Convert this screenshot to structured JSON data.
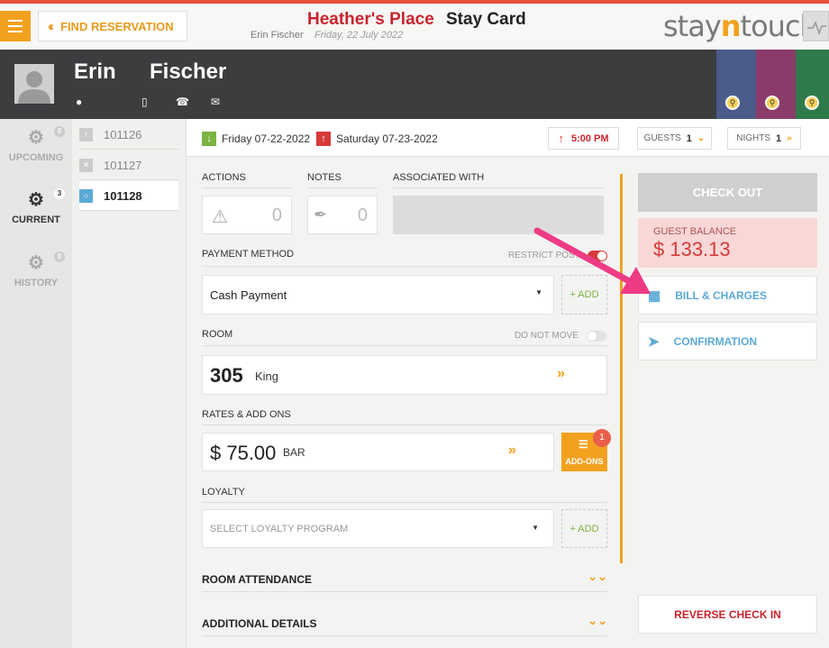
{
  "header": {
    "find_label": "FIND RESERVATION",
    "hotel_name": "Heather's Place",
    "screen_title": "Stay Card",
    "guest_name": "Erin Fischer",
    "date": "Friday, 22 July 2022",
    "logo_left": "stay",
    "logo_mid": "n",
    "logo_right": "touch"
  },
  "guest": {
    "first_name": "Erin",
    "last_name": "Fischer"
  },
  "sidebar": {
    "tabs": [
      {
        "label": "UPCOMING",
        "count": "0"
      },
      {
        "label": "CURRENT",
        "count": "3"
      },
      {
        "label": "HISTORY",
        "count": "0"
      }
    ]
  },
  "reservations": [
    {
      "number": "101126",
      "status": "up"
    },
    {
      "number": "101127",
      "status": "cancelled"
    },
    {
      "number": "101128",
      "status": "current"
    }
  ],
  "dates": {
    "arrival": "Friday 07-22-2022",
    "departure": "Saturday 07-23-2022",
    "time": "5:00 PM",
    "guests_label": "GUESTS",
    "guests_count": "1",
    "nights_label": "NIGHTS",
    "nights_count": "1"
  },
  "actions": {
    "label": "ACTIONS",
    "count": "0"
  },
  "notes": {
    "label": "NOTES",
    "count": "0"
  },
  "associated": {
    "label": "ASSOCIATED WITH"
  },
  "payment": {
    "label": "PAYMENT METHOD",
    "restrict_label": "RESTRICT POST",
    "selected": "Cash Payment",
    "add_label": "+ ADD"
  },
  "room": {
    "label": "ROOM",
    "do_not_move_label": "DO NOT MOVE",
    "number": "305",
    "type": "King"
  },
  "rates": {
    "label": "RATES & ADD ONS",
    "amount": "$ 75.00",
    "code": "BAR",
    "addons_label": "ADD-ONS",
    "addons_count": "1"
  },
  "loyalty": {
    "label": "LOYALTY",
    "placeholder": "SELECT LOYALTY PROGRAM",
    "add_label": "+ ADD"
  },
  "sections": {
    "room_attendance": "ROOM ATTENDANCE",
    "additional_details": "ADDITIONAL DETAILS"
  },
  "right": {
    "checkout_label": "CHECK OUT",
    "balance_label": "GUEST BALANCE",
    "balance_value": "$ 133.13",
    "bill_label": "BILL & CHARGES",
    "confirmation_label": "CONFIRMATION",
    "reverse_label": "REVERSE CHECK IN"
  },
  "colors": {
    "accent": "#f2a11f",
    "danger": "#c8242e",
    "arrow": "#ee3b86",
    "link": "#5aa9d6"
  }
}
